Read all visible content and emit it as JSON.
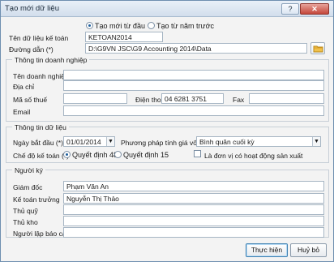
{
  "window": {
    "title": "Tạo mới dữ liệu"
  },
  "mode": {
    "create_new": "Tạo mới từ đầu",
    "from_previous_year": "Tạo từ năm trước"
  },
  "database": {
    "name_label": "Tên dữ liệu kế toán",
    "name_value": "KETOAN2014",
    "path_label": "Đường dẫn (*)",
    "path_value": "D:\\G9VN JSC\\G9 Accounting 2014\\Data"
  },
  "company": {
    "section": "Thông tin doanh nghiệp",
    "name_label": "Tên doanh nghiệp",
    "address_label": "Địa chỉ",
    "tax_label": "Mã số thuế",
    "phone_label": "Điện thoại",
    "phone_value": "04 6281 3751",
    "fax_label": "Fax",
    "email_label": "Email"
  },
  "data_info": {
    "section": "Thông tin dữ liệu",
    "start_date_label": "Ngày bắt đầu (*)",
    "start_date_value": "01/01/2014",
    "costing_label": "Phương pháp tính giá vốn (*)",
    "costing_value": "Bình quân cuối kỳ",
    "regime_label": "Chế độ kế toán (*)",
    "decision_48": "Quyết định 48",
    "decision_15": "Quyết định 15",
    "production_checkbox": "Là đơn vị có hoạt động sản xuất"
  },
  "signers": {
    "section": "Người ký",
    "director_label": "Giám đốc",
    "director_value": "Phạm Văn An",
    "chief_accountant_label": "Kế toán trưởng",
    "chief_accountant_value": "Nguyễn Thị Thảo",
    "cashier_label": "Thủ quỹ",
    "storekeeper_label": "Thủ kho",
    "reporter_label": "Người lập báo cáo"
  },
  "actions": {
    "execute": "Thực hiện",
    "cancel": "Huỷ bỏ"
  }
}
